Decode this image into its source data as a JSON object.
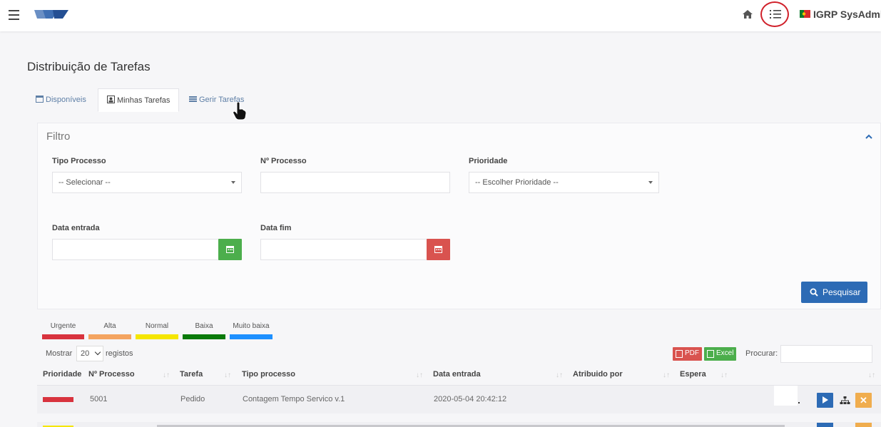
{
  "header": {
    "user_name": "IGRP SysAdmin",
    "icons": [
      "hamburger-menu-icon",
      "igrp-logo",
      "home-icon",
      "list-icon",
      "portugal-flag-icon"
    ]
  },
  "page": {
    "title": "Distribuição de Tarefas"
  },
  "tabs": [
    {
      "label": "Disponíveis",
      "icon": "calendar-icon"
    },
    {
      "label": "Minhas Tarefas",
      "icon": "user-card-icon",
      "active": true
    },
    {
      "label": "Gerir Tarefas",
      "icon": "list-icon"
    }
  ],
  "filter": {
    "title": "Filtro",
    "tipo_processo_label": "Tipo Processo",
    "tipo_processo_value": "-- Selecionar --",
    "numero_processo_label": "Nº Processo",
    "prioridade_label": "Prioridade",
    "prioridade_value": "-- Escolher Prioridade --",
    "data_entrada_label": "Data entrada",
    "data_fim_label": "Data fim",
    "search_button": "Pesquisar"
  },
  "legend": [
    {
      "label": "Urgente",
      "color": "#d8333e"
    },
    {
      "label": "Alta",
      "color": "#f4a460"
    },
    {
      "label": "Normal",
      "color": "#f5e600"
    },
    {
      "label": "Baixa",
      "color": "#0a7a0a"
    },
    {
      "label": "Muito baixa",
      "color": "#1e90ff"
    }
  ],
  "table_controls": {
    "show_label": "Mostrar",
    "page_size": "20",
    "records_label": "registos",
    "pdf_label": "PDF",
    "excel_label": "Excel",
    "search_label": "Procurar:"
  },
  "table": {
    "columns": [
      "Prioridade",
      "Nº Processo",
      "Tarefa",
      "Tipo processo",
      "Data entrada",
      "Atribuido por",
      "Espera"
    ],
    "rows": [
      {
        "priority": "Urgente",
        "numero": "5001",
        "tarefa": "Pedido",
        "tipo": "Contagem Tempo Servico v.1",
        "data_entrada": "2020-05-04 20:42:12",
        "atribuido_por": "",
        "espera": ""
      }
    ]
  }
}
